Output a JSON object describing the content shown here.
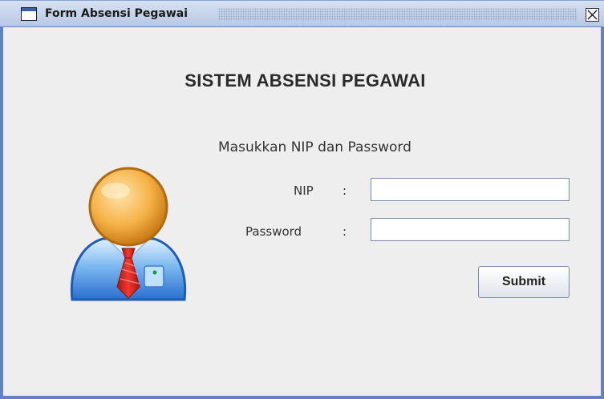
{
  "window": {
    "title": "Form Absensi Pegawai"
  },
  "form": {
    "heading": "SISTEM ABSENSI PEGAWAI",
    "subtitle": "Masukkan NIP dan Password",
    "nip_label": "NIP",
    "password_label": "Password",
    "colon": ":",
    "nip_value": "",
    "password_value": "",
    "submit_label": "Submit"
  },
  "icons": {
    "window": "window-icon",
    "close": "close-icon",
    "user": "user-avatar-icon"
  },
  "colors": {
    "window_border": "#6382bf",
    "background": "#eeeeee",
    "tie": "#d8201c",
    "shirt": "#4a90e2",
    "face": "#f5b247"
  }
}
